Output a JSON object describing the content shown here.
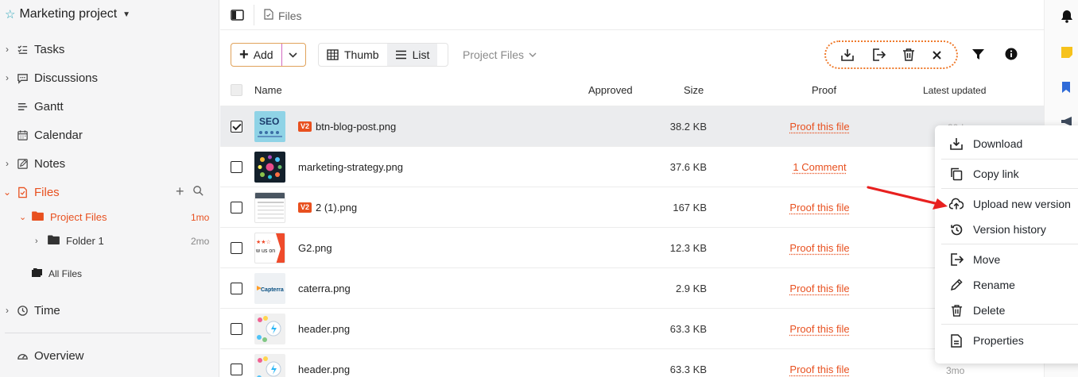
{
  "sidebar": {
    "project_name": "Marketing project",
    "items": [
      {
        "label": "Tasks",
        "icon": "tasks-icon"
      },
      {
        "label": "Discussions",
        "icon": "chat-icon"
      },
      {
        "label": "Gantt",
        "icon": "gantt-icon"
      },
      {
        "label": "Calendar",
        "icon": "calendar-icon"
      },
      {
        "label": "Notes",
        "icon": "notes-icon"
      },
      {
        "label": "Files",
        "icon": "file-icon"
      },
      {
        "label": "Time",
        "icon": "clock-icon"
      },
      {
        "label": "Overview",
        "icon": "gauge-icon"
      }
    ],
    "project_files": {
      "label": "Project Files",
      "meta": "1mo"
    },
    "folder1": {
      "label": "Folder 1",
      "meta": "2mo"
    },
    "all_files": {
      "label": "All Files"
    }
  },
  "breadcrumb": {
    "label": "Files"
  },
  "toolbar": {
    "add_label": "Add",
    "thumb_label": "Thumb",
    "list_label": "List",
    "folder_label": "Project Files"
  },
  "table": {
    "headers": {
      "name": "Name",
      "approved": "Approved",
      "size": "Size",
      "proof": "Proof",
      "updated": "Latest updated"
    },
    "rows": [
      {
        "name": "btn-blog-post.png",
        "badge": "V2",
        "size": "38.2 KB",
        "proof": "Proof this file",
        "ago": "30d"
      },
      {
        "name": "marketing-strategy.png",
        "badge": "",
        "size": "37.6 KB",
        "proof": "1 Comment",
        "ago": ""
      },
      {
        "name": "2 (1).png",
        "badge": "V2",
        "size": "167 KB",
        "proof": "Proof this file",
        "ago": ""
      },
      {
        "name": "G2.png",
        "badge": "",
        "size": "12.3 KB",
        "proof": "Proof this file",
        "ago": ""
      },
      {
        "name": "caterra.png",
        "badge": "",
        "size": "2.9 KB",
        "proof": "Proof this file",
        "ago": ""
      },
      {
        "name": "header.png",
        "badge": "",
        "size": "63.3 KB",
        "proof": "Proof this file",
        "ago": ""
      },
      {
        "name": "header.png",
        "badge": "",
        "size": "63.3 KB",
        "proof": "Proof this file",
        "ago": "3mo"
      }
    ],
    "thumb_text": {
      "seo": "SEO",
      "g2": "w us on",
      "capterra": "Capterra"
    }
  },
  "context_menu": {
    "items": [
      {
        "label": "Download",
        "icon": "download-icon"
      },
      {
        "label": "Copy link",
        "icon": "copy-icon"
      },
      {
        "label": "Upload new version",
        "icon": "upload-cloud-icon"
      },
      {
        "label": "Version history",
        "icon": "history-icon"
      },
      {
        "label": "Move",
        "icon": "move-icon"
      },
      {
        "label": "Rename",
        "icon": "pencil-icon"
      },
      {
        "label": "Delete",
        "icon": "trash-icon"
      },
      {
        "label": "Properties",
        "icon": "document-icon"
      }
    ]
  },
  "colors": {
    "accent": "#e8501f",
    "annotation": "#e8201f",
    "teal": "#2aa6b8"
  }
}
